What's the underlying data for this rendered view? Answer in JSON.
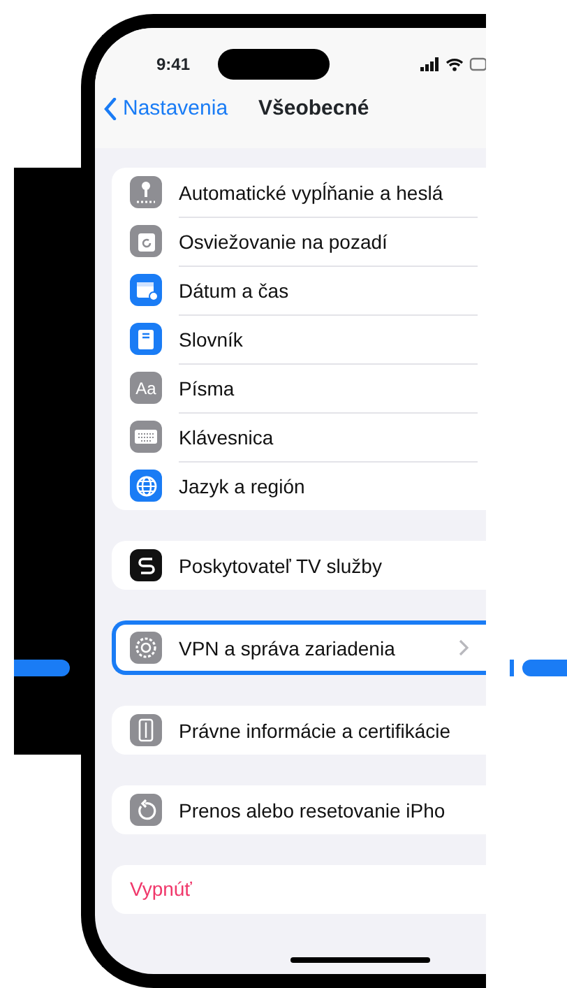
{
  "status_bar": {
    "time": "9:41"
  },
  "nav": {
    "back": "Nastavenia",
    "title": "Všeobecné"
  },
  "groups": [
    {
      "rows": [
        {
          "label": "Automatické vypĺňanie a heslá",
          "kind": "key",
          "color": "#8e8e93",
          "selected": false
        },
        {
          "label": "Osviežovanie na pozadí",
          "kind": "refresh-box",
          "color": "#8e8e93",
          "selected": false
        },
        {
          "label": "Dátum a čas",
          "kind": "calendar",
          "color": "#1a7cf5",
          "selected": false
        },
        {
          "label": "Slovník",
          "kind": "book",
          "color": "#1a7cf5",
          "selected": false
        },
        {
          "label": "Písma",
          "kind": "text",
          "icon_text": "Aa",
          "color": "#8e8e93",
          "selected": false
        },
        {
          "label": "Klávesnica",
          "kind": "keyboard",
          "color": "#8e8e93",
          "selected": false
        },
        {
          "label": "Jazyk a región",
          "kind": "globe",
          "color": "#1a7cf5",
          "selected": false
        }
      ]
    },
    {
      "rows": [
        {
          "label": "Poskytovateľ TV služby",
          "kind": "cable",
          "color": "#111111",
          "selected": false
        }
      ]
    },
    {
      "rows": [
        {
          "label": "VPN a správa zariadenia",
          "kind": "gear",
          "color": "#8e8e93",
          "selected": true
        }
      ]
    },
    {
      "rows": [
        {
          "label": "Právne informácie a certifikácie",
          "kind": "document",
          "color": "#8e8e93",
          "selected": false
        }
      ]
    },
    {
      "rows": [
        {
          "label": "Prenos alebo resetovanie iPho",
          "kind": "reset",
          "color": "#8e8e93",
          "selected": false
        }
      ]
    }
  ],
  "shutdown": {
    "label": "Vypnúť"
  }
}
